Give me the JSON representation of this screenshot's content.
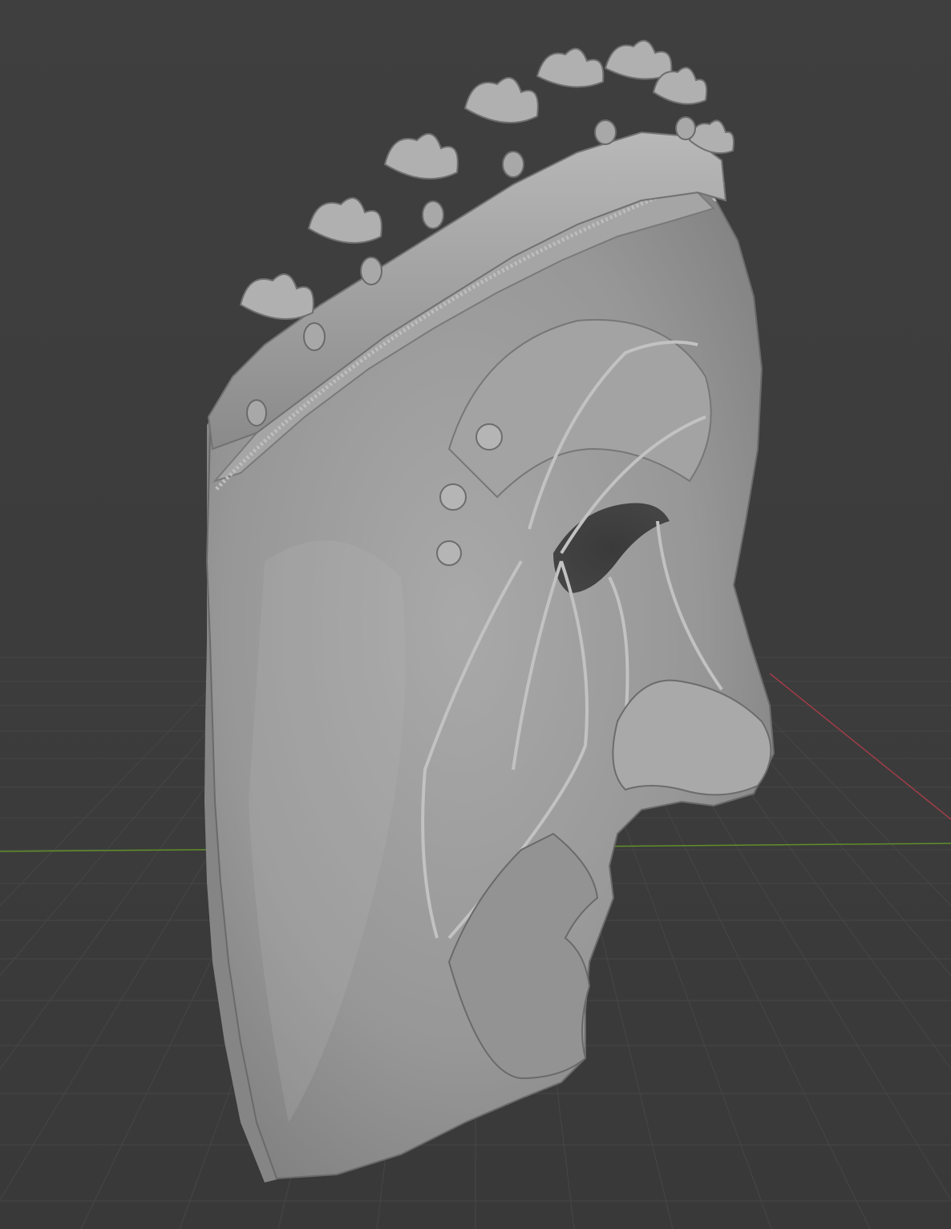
{
  "viewport": {
    "background_color": "#3d3d3d",
    "grid_color": "#4a4a4a",
    "x_axis_color": "#b3434f",
    "y_axis_color": "#6a9a2c",
    "model": {
      "type": "sculpted-mask",
      "color": "#9a9a9a",
      "shadow_color": "#6e6e6e",
      "highlight_color": "#c4c4c4"
    }
  }
}
